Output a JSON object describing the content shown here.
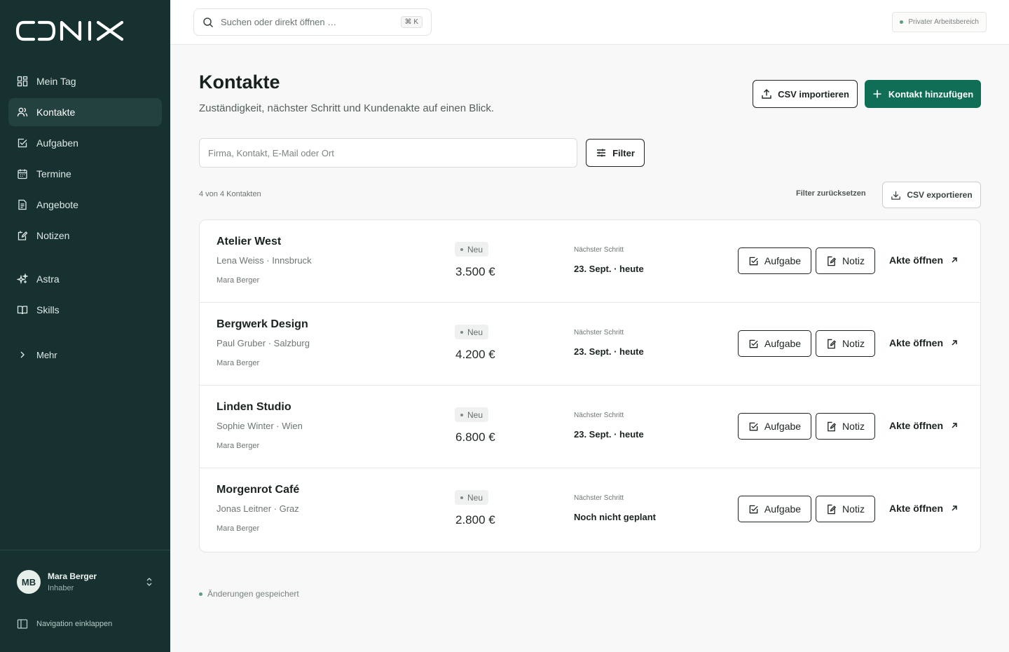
{
  "brand": {
    "logo_text": "CONIX"
  },
  "sidebar": {
    "items": [
      {
        "label": "Mein Tag",
        "icon": "dashboard-icon"
      },
      {
        "label": "Kontakte",
        "icon": "users-icon"
      },
      {
        "label": "Aufgaben",
        "icon": "checkbox-icon"
      },
      {
        "label": "Termine",
        "icon": "calendar-icon"
      },
      {
        "label": "Angebote",
        "icon": "document-icon"
      },
      {
        "label": "Notizen",
        "icon": "note-icon"
      }
    ],
    "secondary": [
      {
        "label": "Astra",
        "icon": "sparkles-icon"
      },
      {
        "label": "Skills",
        "icon": "book-icon"
      }
    ],
    "more_label": "Mehr",
    "user": {
      "initials": "MB",
      "name": "Mara Berger",
      "role": "Inhaber"
    },
    "collapse_label": "Navigation einklappen"
  },
  "topbar": {
    "search_placeholder": "Suchen oder direkt öffnen …",
    "shortcut": "⌘ K",
    "workspace": "Privater Arbeitsbereich"
  },
  "page": {
    "title": "Kontakte",
    "subtitle": "Zuständigkeit, nächster Schritt und Kundenakte auf einen Blick.",
    "import_label": "CSV importieren",
    "add_label": "Kontakt hinzufügen",
    "filter_placeholder": "Firma, Kontakt, E-Mail oder Ort",
    "filter_label": "Filter",
    "count_text": "4 von 4 Kontakten",
    "reset_label": "Filter zurücksetzen",
    "export_label": "CSV exportieren",
    "saved_text": "Änderungen gespeichert"
  },
  "contacts": [
    {
      "company": "Atelier West",
      "person": "Lena Weiss · Innsbruck",
      "owner": "Mara Berger",
      "status": "Neu",
      "amount": "3.500 €",
      "next_label": "Nächster Schritt",
      "next_value": "23. Sept. · heute",
      "task_label": "Aufgabe",
      "note_label": "Notiz",
      "open_label": "Akte öffnen"
    },
    {
      "company": "Bergwerk Design",
      "person": "Paul Gruber · Salzburg",
      "owner": "Mara Berger",
      "status": "Neu",
      "amount": "4.200 €",
      "next_label": "Nächster Schritt",
      "next_value": "23. Sept. · heute",
      "task_label": "Aufgabe",
      "note_label": "Notiz",
      "open_label": "Akte öffnen"
    },
    {
      "company": "Linden Studio",
      "person": "Sophie Winter · Wien",
      "owner": "Mara Berger",
      "status": "Neu",
      "amount": "6.800 €",
      "next_label": "Nächster Schritt",
      "next_value": "23. Sept. · heute",
      "task_label": "Aufgabe",
      "note_label": "Notiz",
      "open_label": "Akte öffnen"
    },
    {
      "company": "Morgenrot Café",
      "person": "Jonas Leitner · Graz",
      "owner": "Mara Berger",
      "status": "Neu",
      "amount": "2.800 €",
      "next_label": "Nächster Schritt",
      "next_value": "Noch nicht geplant",
      "task_label": "Aufgabe",
      "note_label": "Notiz",
      "open_label": "Akte öffnen"
    }
  ],
  "colors": {
    "sidebar": "#163130",
    "accent": "#0f6e55",
    "active_nav": "#23423f"
  }
}
